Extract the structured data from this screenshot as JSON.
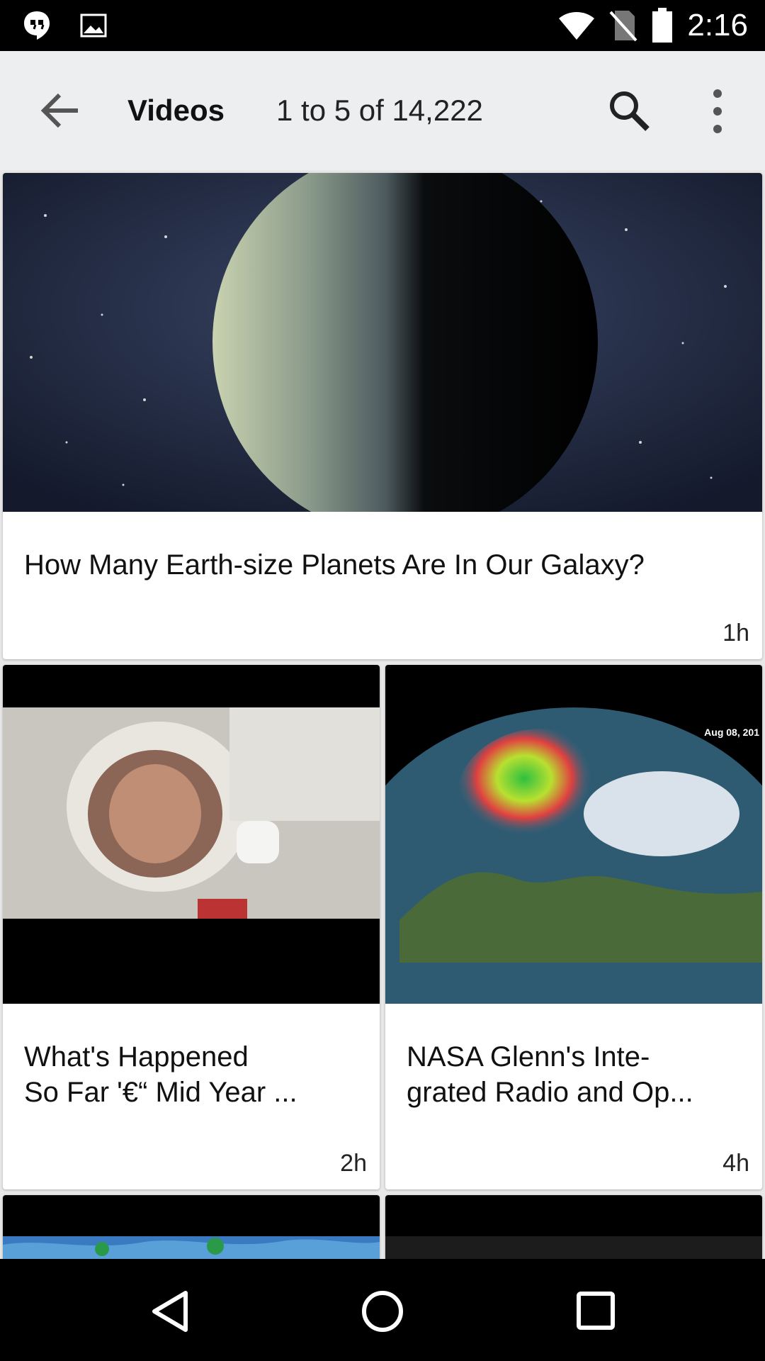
{
  "status_bar": {
    "time": "2:16",
    "icons": [
      "hangouts-icon",
      "gallery-icon",
      "wifi-icon",
      "no-sim-icon",
      "battery-icon"
    ]
  },
  "app_bar": {
    "title": "Videos",
    "count_label": "1 to 5 of 14,222",
    "icons": [
      "back-arrow-icon",
      "search-icon",
      "overflow-menu-icon"
    ]
  },
  "videos": [
    {
      "title": "How Many Earth-size Planets Are In Our Galaxy?",
      "age": "1h"
    },
    {
      "title_line1": "What's Happened",
      "title_line2": "So Far '€“ Mid Year ...",
      "age": "2h"
    },
    {
      "title_line1": "NASA Glenn's Inte-",
      "title_line2": "grated Radio and Op...",
      "age": "4h",
      "thumb_overlay": "Aug 08, 201"
    }
  ],
  "nav_bar": {
    "icons": [
      "back-triangle-icon",
      "home-circle-icon",
      "recents-square-icon"
    ]
  },
  "colors": {
    "status_bar": "#000000",
    "app_bar": "#eceeef",
    "background": "#e8e8e8",
    "card": "#ffffff"
  }
}
